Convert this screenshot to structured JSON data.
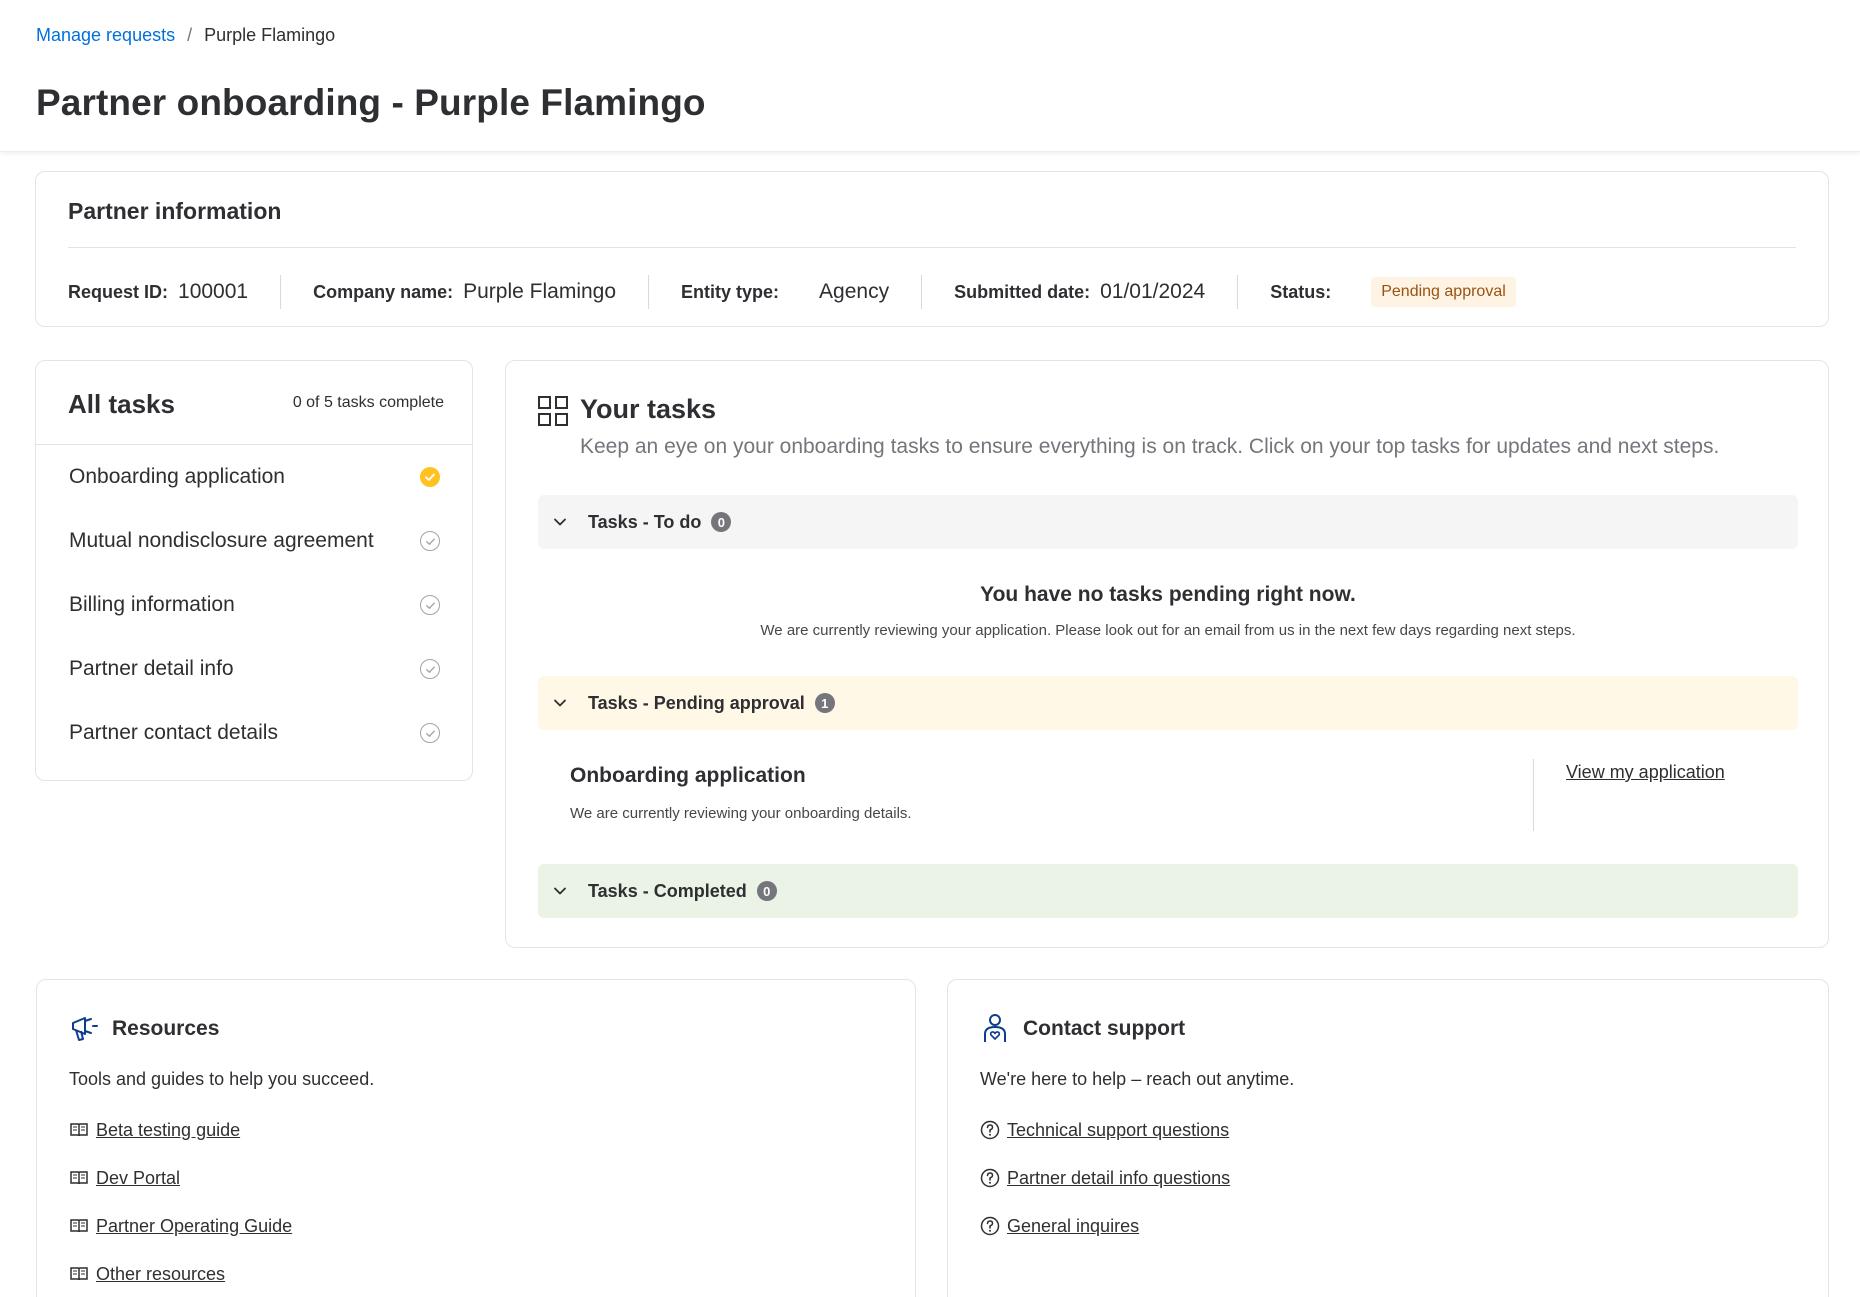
{
  "breadcrumb": {
    "parent": "Manage requests",
    "separator": "/",
    "current": "Purple Flamingo"
  },
  "page_title": "Partner onboarding - Purple Flamingo",
  "partner_info": {
    "title": "Partner information",
    "fields": [
      {
        "label": "Request ID:",
        "value": "100001"
      },
      {
        "label": "Company name:",
        "value": "Purple Flamingo"
      },
      {
        "label": "Entity type:",
        "value": "Agency"
      },
      {
        "label": "Submitted date:",
        "value": "01/01/2024"
      }
    ],
    "status_label": "Status:",
    "status_value": "Pending approval"
  },
  "all_tasks": {
    "title": "All tasks",
    "progress": "0 of 5 tasks complete",
    "items": [
      {
        "label": "Onboarding application",
        "state": "in-progress"
      },
      {
        "label": "Mutual nondisclosure agreement",
        "state": "not-started"
      },
      {
        "label": "Billing information",
        "state": "not-started"
      },
      {
        "label": "Partner detail info",
        "state": "not-started"
      },
      {
        "label": "Partner contact details",
        "state": "not-started"
      }
    ]
  },
  "your_tasks": {
    "title": "Your tasks",
    "subtitle": "Keep an eye on your onboarding tasks to ensure everything is on track. Click on your top tasks for updates and next steps.",
    "sections": {
      "todo": {
        "label": "Tasks - To do",
        "count": "0"
      },
      "pending": {
        "label": "Tasks - Pending approval",
        "count": "1"
      },
      "completed": {
        "label": "Tasks - Completed",
        "count": "0"
      }
    },
    "empty_title": "You have no tasks pending right now.",
    "empty_text": "We are currently reviewing your application. Please look out for an email from us in the next few days regarding next steps.",
    "pending_task": {
      "title": "Onboarding application",
      "description": "We are currently reviewing your onboarding details.",
      "link": "View my application"
    }
  },
  "resources": {
    "title": "Resources",
    "subtitle": "Tools and guides to help you succeed.",
    "links": [
      "Beta testing guide",
      "Dev Portal",
      "Partner Operating Guide",
      "Other resources"
    ]
  },
  "contact": {
    "title": "Contact support",
    "subtitle": "We're here to help – reach out anytime.",
    "links": [
      "Technical support questions",
      "Partner detail info questions",
      "General inquires"
    ]
  },
  "colors": {
    "link_blue": "#0071dc",
    "status_bg": "#fff4e3",
    "status_text": "#995213",
    "check_yellow": "#ffc220",
    "pending_bar": "#fff8e7",
    "completed_bar": "#eaf3e6",
    "todo_bar": "#f5f5f5"
  },
  "icons": {
    "your_tasks": "grid-icon",
    "resources": "megaphone-icon",
    "contact": "support-person-icon",
    "resource_link": "book-icon",
    "contact_link": "help-circle-icon",
    "section_toggle": "chevron-down-icon"
  }
}
